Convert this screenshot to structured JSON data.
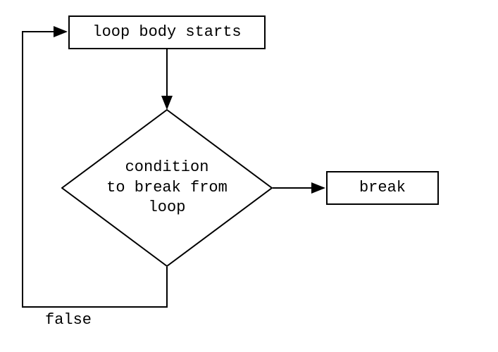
{
  "flow": {
    "start": {
      "label": "loop body starts"
    },
    "condition": {
      "label": "condition\nto break from\nloop"
    },
    "break": {
      "label": "break"
    },
    "edge_false": {
      "label": "false"
    }
  }
}
